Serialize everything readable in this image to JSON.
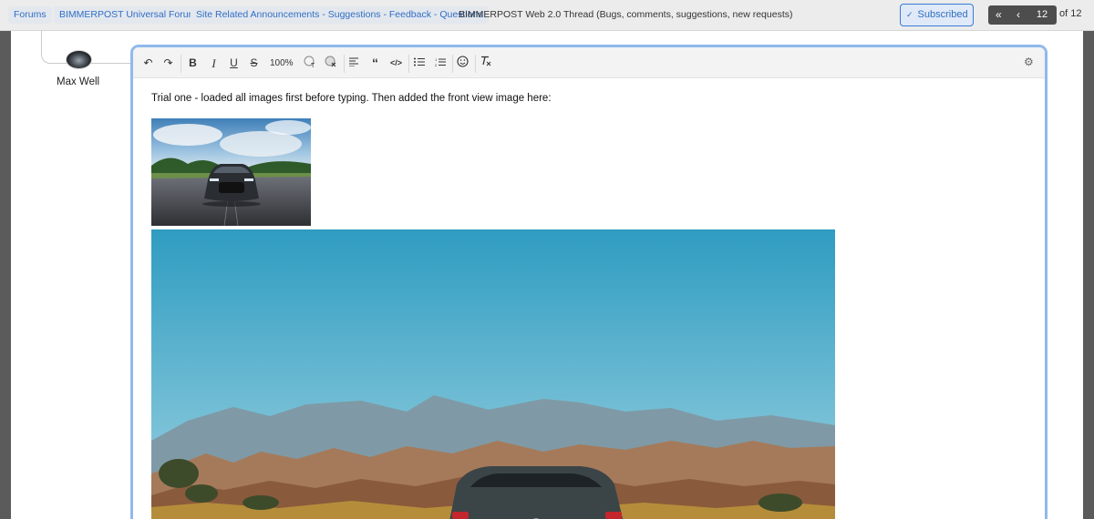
{
  "breadcrumbs": [
    "Forums",
    "BIMMERPOST Universal Forums",
    "Site Related Announcements - Suggestions - Feedback - Questions"
  ],
  "thread_title": "BIMMERPOST Web 2.0 Thread (Bugs, comments, suggestions, new requests)",
  "subscribed_label": "Subscribed",
  "pagination": {
    "current_page": "12",
    "total_label": "of 12"
  },
  "author": {
    "name": "Max Well"
  },
  "editor": {
    "zoom": "100%",
    "body_text": "Trial one - loaded all images first before typing. Then added the front view image here:",
    "toolbar_icons": [
      "undo-icon",
      "redo-icon",
      "bold-icon",
      "italic-icon",
      "underline-icon",
      "strikethrough-icon",
      "zoom",
      "text-color-icon",
      "background-color-icon",
      "align-icon",
      "quote-icon",
      "code-icon",
      "bullet-list-icon",
      "numbered-list-icon",
      "emoji-icon",
      "clear-formatting-icon",
      "settings-gear-icon"
    ]
  },
  "colors": {
    "accent": "#2f6fc4",
    "editor_border": "#8fb9ec",
    "pager_bg": "#4d4d4d"
  }
}
